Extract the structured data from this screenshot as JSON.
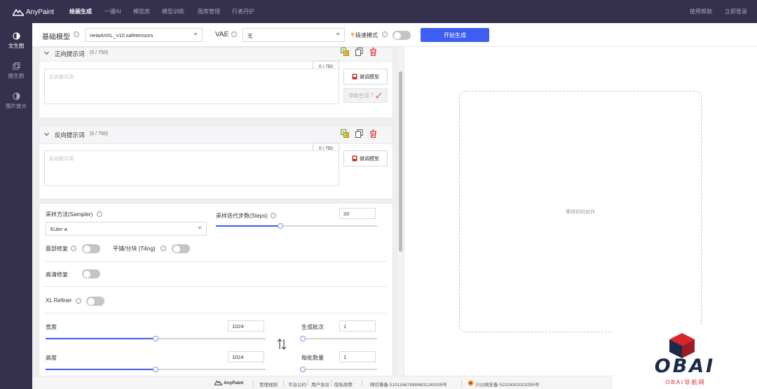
{
  "brand": {
    "name": "AnyPaint"
  },
  "nav": {
    "items": [
      "绘画生成",
      "一键AI",
      "模型库",
      "模型训练",
      "图库管理",
      "行者丹护"
    ],
    "active": 0,
    "right": [
      "使用帮助",
      "立即登录"
    ]
  },
  "sidenav": [
    {
      "label": "文生图",
      "icon": "contrast-icon",
      "active": true
    },
    {
      "label": "图生图",
      "icon": "images-icon",
      "active": false
    },
    {
      "label": "图片放大",
      "icon": "contrast-icon",
      "active": false
    }
  ],
  "config": {
    "base_model_label": "基础模型",
    "base_model_value": "netaArtXL_v10.safetensors",
    "vae_label": "VAE",
    "vae_value": "无",
    "fast_mode_label": "极速模式",
    "fast_mode_on": false,
    "start_button": "开始生成"
  },
  "positive": {
    "title": "正向提示词",
    "count": "(0 / 750)",
    "placeholder": "正向提示词",
    "counter": "0 / 750",
    "finetune_button": "微调模型",
    "assist_button": "帮助生词"
  },
  "negative": {
    "title": "反向提示词",
    "count": "(0 / 750)",
    "placeholder": "反向提示词",
    "counter": "0 / 750",
    "finetune_button": "微调模型"
  },
  "params": {
    "sampler_label": "采样方法(Sampler)",
    "sampler_value": "Euler a",
    "steps_label": "采样迭代步数(Steps)",
    "steps_value": "20",
    "steps_fraction": 0.4,
    "face_fix_label": "面部修复",
    "face_fix_on": false,
    "tiling_label": "平铺/分块 (Tiling)",
    "tiling_on": false,
    "hires_label": "高清修复",
    "hires_on": false,
    "refiner_label": "XL Refiner",
    "refiner_on": false,
    "width_label": "宽度",
    "width_value": "1024",
    "width_fraction": 0.5,
    "height_label": "高度",
    "height_value": "1024",
    "height_fraction": 0.5,
    "batch_count_label": "生成批次",
    "batch_count_value": "1",
    "batch_size_label": "每批数量",
    "batch_size_value": "1",
    "swap_icon": "swap-vertical-icon"
  },
  "preview": {
    "placeholder": "等待你的创作"
  },
  "footer": {
    "logo": "AnyPaint",
    "links": [
      "管理规则",
      "平台公约",
      "用户协议",
      "隐私政策"
    ],
    "icp": "网信算备 510116674984601240039号",
    "police": "川公网安备 51019002003295号"
  },
  "watermark": {
    "text": "OBAI",
    "subtitle": "O B A I 导 航 网",
    "colors": {
      "red": "#d9262d",
      "navy": "#1c2a4a"
    }
  }
}
